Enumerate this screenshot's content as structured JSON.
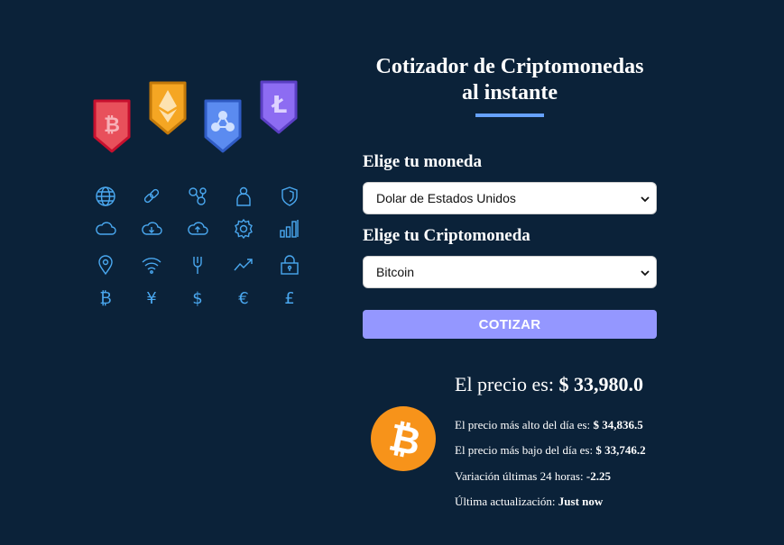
{
  "header": {
    "title_line1": "Cotizador de Criptomonedas",
    "title_line2": "al instante"
  },
  "form": {
    "currency_label": "Elige tu moneda",
    "currency_selected": "Dolar de Estados Unidos",
    "crypto_label": "Elige tu Criptomoneda",
    "crypto_selected": "Bitcoin",
    "submit_label": "COTIZAR"
  },
  "result": {
    "price_label": "El precio es:",
    "price_value": "$ 33,980.0",
    "high_label": "El precio más alto del día es:",
    "high_value": "$ 34,836.5",
    "low_label": "El precio más bajo del día es:",
    "low_value": "$ 33,746.2",
    "change_label": "Variación últimas 24 horas:",
    "change_value": "-2.25",
    "updated_label": "Última actualización:",
    "updated_value": "Just now"
  },
  "illustration": {
    "badges": [
      "bitcoin-icon",
      "ethereum-icon",
      "ripple-icon",
      "litecoin-icon"
    ],
    "grid_icons": [
      "globe-icon",
      "link-icon",
      "network-icon",
      "user-icon",
      "shield-icon",
      "cloud-icon",
      "cloud-download-icon",
      "cloud-upload-icon",
      "gear-icon",
      "bar-chart-icon",
      "location-pin-icon",
      "wifi-icon",
      "fork-icon",
      "trend-up-icon",
      "lock-icon",
      "bitcoin-symbol-icon",
      "yen-icon",
      "dollar-icon",
      "euro-icon",
      "pound-icon"
    ]
  },
  "colors": {
    "background": "#0b2239",
    "accent": "#66a2fe",
    "button": "#9497ff",
    "bitcoin": "#f7931a",
    "icon_stroke": "#4aa8f0"
  }
}
